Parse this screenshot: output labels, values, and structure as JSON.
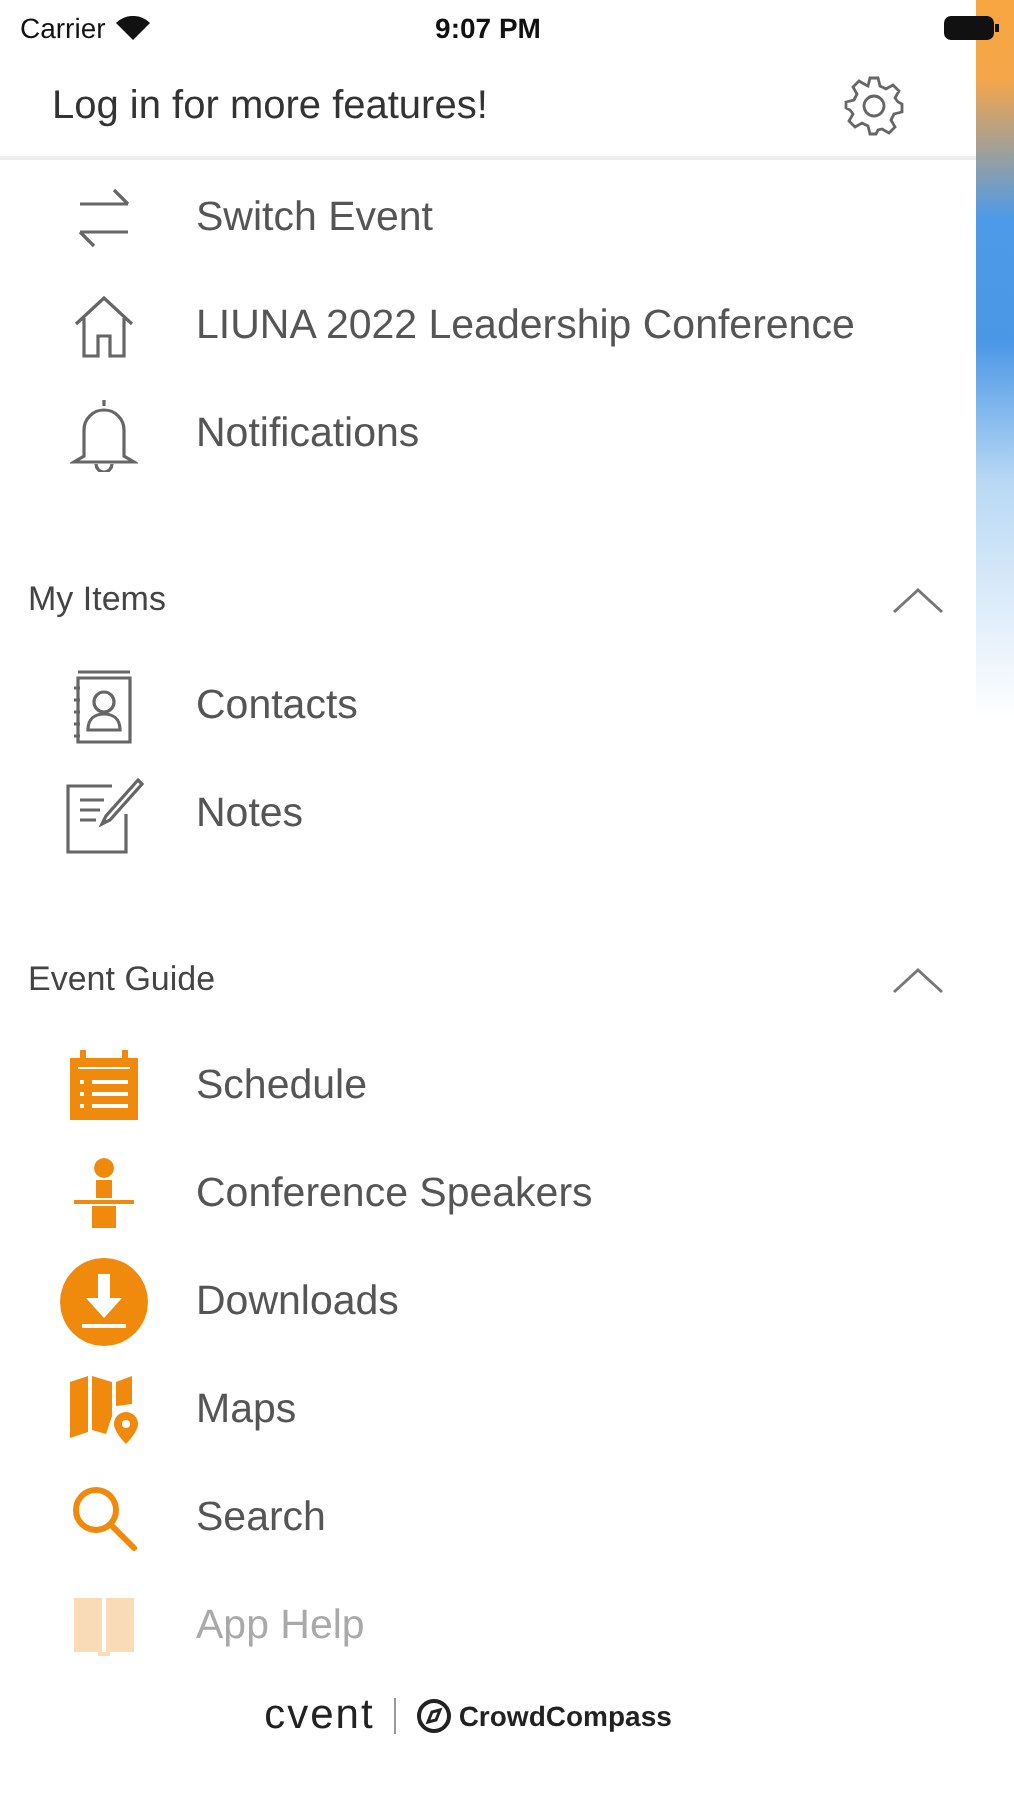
{
  "status_bar": {
    "carrier": "Carrier",
    "time": "9:07 PM"
  },
  "header": {
    "title": "Log in for more features!"
  },
  "top_items": [
    {
      "label": "Switch Event"
    },
    {
      "label": "LIUNA 2022 Leadership Conference"
    },
    {
      "label": "Notifications"
    }
  ],
  "sections": [
    {
      "title": "My Items",
      "expanded": true,
      "items": [
        {
          "label": "Contacts"
        },
        {
          "label": "Notes"
        }
      ]
    },
    {
      "title": "Event Guide",
      "expanded": true,
      "items": [
        {
          "label": "Schedule"
        },
        {
          "label": "Conference Speakers"
        },
        {
          "label": "Downloads"
        },
        {
          "label": "Maps"
        },
        {
          "label": "Search"
        },
        {
          "label": "App Help"
        }
      ]
    }
  ],
  "footer": {
    "brand": "cvent",
    "partner": "CrowdCompass"
  }
}
